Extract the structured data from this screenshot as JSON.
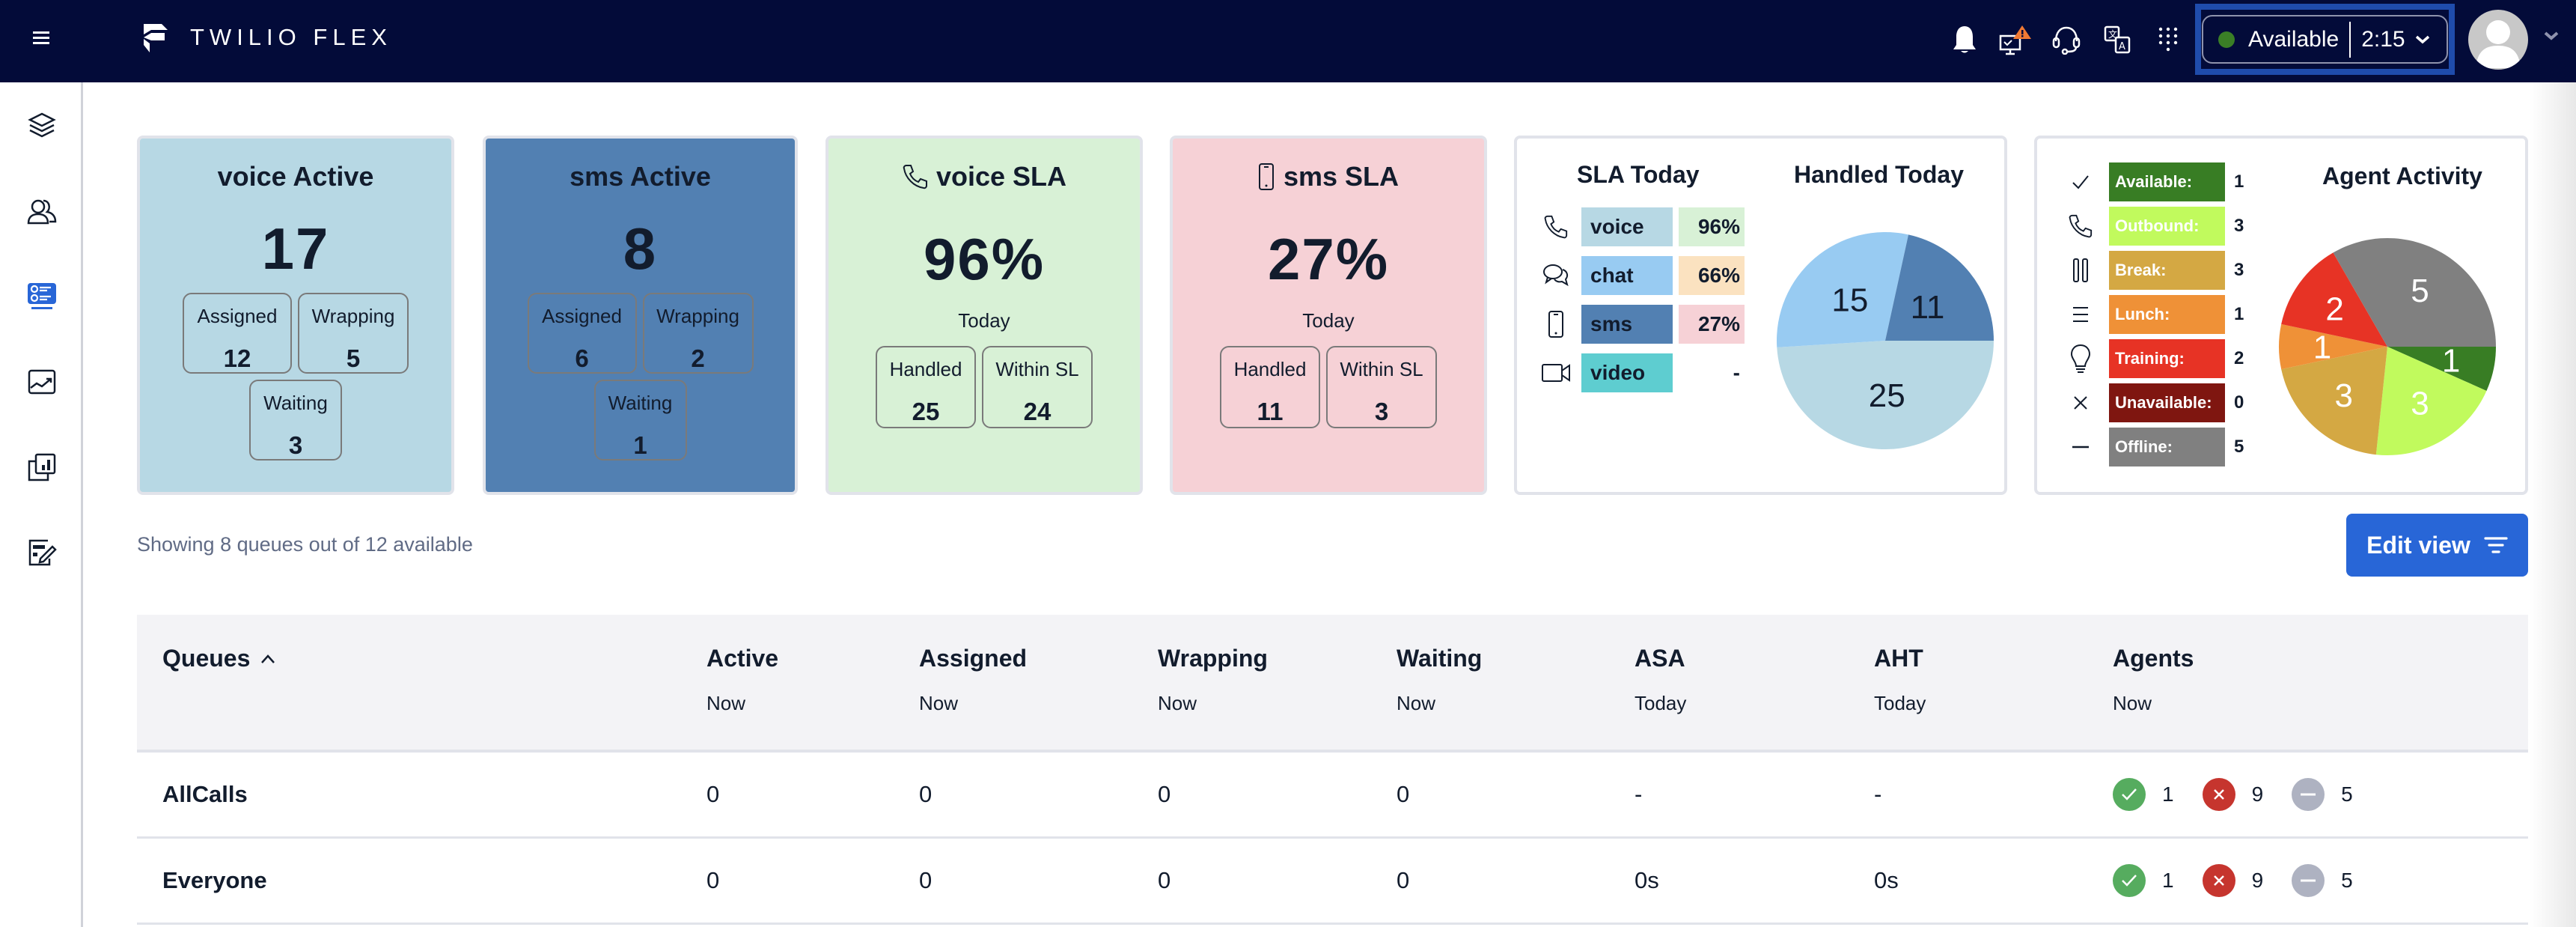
{
  "header": {
    "brand": "TWILIO FLEX",
    "status": {
      "label": "Available",
      "timer": "2:15",
      "color": "#3a7f26"
    },
    "icons": [
      "bell-icon",
      "monitor-alert-icon",
      "headset-icon",
      "translate-icon",
      "dialpad-icon"
    ]
  },
  "sidebar": {
    "items": [
      {
        "name": "layers",
        "active": false
      },
      {
        "name": "teams",
        "active": false
      },
      {
        "name": "queues-stats",
        "active": true
      },
      {
        "name": "insights",
        "active": false
      },
      {
        "name": "reports",
        "active": false
      },
      {
        "name": "edit-form",
        "active": false
      }
    ]
  },
  "tiles": {
    "voice_active": {
      "title": "voice Active",
      "value": "17",
      "color": "#b7d8e4",
      "subs": [
        {
          "label": "Assigned",
          "value": "12"
        },
        {
          "label": "Wrapping",
          "value": "5"
        },
        {
          "label": "Waiting",
          "value": "3"
        }
      ]
    },
    "sms_active": {
      "title": "sms Active",
      "value": "8",
      "color": "#5280b2",
      "subs": [
        {
          "label": "Assigned",
          "value": "6"
        },
        {
          "label": "Wrapping",
          "value": "2"
        },
        {
          "label": "Waiting",
          "value": "1"
        }
      ]
    },
    "voice_sla": {
      "title": "voice SLA",
      "value": "96%",
      "period": "Today",
      "color": "#d8f1d6",
      "subs": [
        {
          "label": "Handled",
          "value": "25"
        },
        {
          "label": "Within SL",
          "value": "24"
        }
      ]
    },
    "sms_sla": {
      "title": "sms SLA",
      "value": "27%",
      "period": "Today",
      "color": "#f6d1d6",
      "subs": [
        {
          "label": "Handled",
          "value": "11"
        },
        {
          "label": "Within SL",
          "value": "3"
        }
      ]
    }
  },
  "sla_today": {
    "title": "SLA Today",
    "rows": [
      {
        "channel": "voice",
        "pct": "96%",
        "color": "#b7d8e4",
        "pct_color": "#d8f1d6"
      },
      {
        "channel": "chat",
        "pct": "66%",
        "color": "#98cbf2",
        "pct_color": "#fbe2c0"
      },
      {
        "channel": "sms",
        "pct": "27%",
        "color": "#5280b2",
        "pct_color": "#f6d1d6"
      },
      {
        "channel": "video",
        "pct": "-",
        "color": "#5ecdd0",
        "pct_color": "#ffffff"
      }
    ]
  },
  "agent_activity": {
    "title": "Agent Activity",
    "rows": [
      {
        "label": "Available:",
        "value": "1",
        "color": "#387d24"
      },
      {
        "label": "Outbound:",
        "value": "3",
        "color": "#c1fa5d"
      },
      {
        "label": "Break:",
        "value": "3",
        "color": "#d4a843"
      },
      {
        "label": "Lunch:",
        "value": "1",
        "color": "#ef9137"
      },
      {
        "label": "Training:",
        "value": "2",
        "color": "#e73325"
      },
      {
        "label": "Unavailable:",
        "value": "0",
        "color": "#7f1610"
      },
      {
        "label": "Offline:",
        "value": "5",
        "color": "#808080"
      }
    ]
  },
  "chart_data": [
    {
      "type": "pie",
      "title": "Handled Today",
      "categories": [
        "voice",
        "chat",
        "sms"
      ],
      "values": [
        25,
        15,
        11
      ],
      "colors": [
        "#b7d8e4",
        "#98cbf2",
        "#5280b2"
      ],
      "start": "3-o-clock",
      "direction": "clockwise"
    },
    {
      "type": "pie",
      "title": "Agent Activity",
      "categories": [
        "Available",
        "Outbound",
        "Break",
        "Lunch",
        "Training",
        "Unavailable",
        "Offline"
      ],
      "values": [
        1,
        3,
        3,
        1,
        2,
        0,
        5
      ],
      "colors": [
        "#387d24",
        "#c1fa5d",
        "#d4a843",
        "#ef9137",
        "#e73325",
        "#7f1610",
        "#808080"
      ],
      "start": "3-o-clock",
      "direction": "clockwise"
    }
  ],
  "showing_text": "Showing 8 queues out of 12 available",
  "edit_view_label": "Edit view",
  "table": {
    "columns": [
      {
        "label": "Queues",
        "sub": ""
      },
      {
        "label": "Active",
        "sub": "Now"
      },
      {
        "label": "Assigned",
        "sub": "Now"
      },
      {
        "label": "Wrapping",
        "sub": "Now"
      },
      {
        "label": "Waiting",
        "sub": "Now"
      },
      {
        "label": "ASA",
        "sub": "Today"
      },
      {
        "label": "AHT",
        "sub": "Today"
      },
      {
        "label": "Agents",
        "sub": "Now"
      }
    ],
    "rows": [
      {
        "queue": "AllCalls",
        "active": "0",
        "assigned": "0",
        "wrapping": "0",
        "waiting": "0",
        "asa": "-",
        "aht": "-",
        "agents": {
          "available": "1",
          "unavailable": "9",
          "offline": "5"
        }
      },
      {
        "queue": "Everyone",
        "active": "0",
        "assigned": "0",
        "wrapping": "0",
        "waiting": "0",
        "asa": "0s",
        "aht": "0s",
        "agents": {
          "available": "1",
          "unavailable": "9",
          "offline": "5"
        }
      }
    ]
  }
}
